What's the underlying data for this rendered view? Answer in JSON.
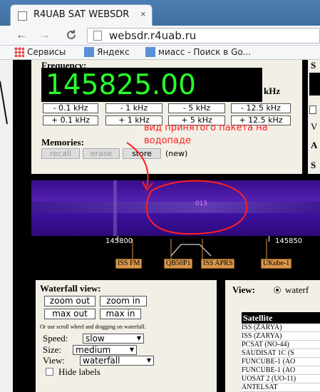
{
  "browser": {
    "tab_title": "R4UAB SAT WEBSDR",
    "tab_close": "×",
    "back": "←",
    "forward": "→",
    "reload": "C",
    "url": "websdr.r4uab.ru",
    "bookmarks": [
      {
        "label": "Сервисы",
        "icon": "apps-grid-icon"
      },
      {
        "label": "Яндекс",
        "icon": "bookmark-icon"
      },
      {
        "label": "миасс - Поиск в Go...",
        "icon": "bookmark-icon"
      }
    ]
  },
  "frequency": {
    "label": "Frequency:",
    "value": "145825.00",
    "unit": "kHz",
    "steps_row1": [
      "- 0.1 kHz",
      "- 1 kHz",
      "- 5 kHz",
      "- 12.5 kHz"
    ],
    "steps_row2": [
      "+ 0.1 kHz",
      "+ 1 kHz",
      "+ 5 kHz",
      "+ 12.5 kHz"
    ]
  },
  "memories": {
    "label": "Memories:",
    "recall": "recall",
    "erase": "erase",
    "store": "store",
    "new": "(new)"
  },
  "right_panel_letters": [
    "S",
    "V",
    "A",
    "S"
  ],
  "annotation": "вид принятого пакета на водопаде",
  "waterfall_signal_text": "015",
  "scale": {
    "tick_left": "145800",
    "tick_right": "145850",
    "satellites": [
      "ISS FM",
      "QB50P1",
      "ISS APRS",
      "UKube-1"
    ]
  },
  "waterfall_view": {
    "title": "Waterfall view:",
    "zoom_out": "zoom out",
    "zoom_in": "zoom in",
    "max_out": "max out",
    "max_in": "max in",
    "hint": "Or use scroll wheel and dragging on waterfall.",
    "speed_label": "Speed:",
    "speed_value": "slow",
    "size_label": "Size:",
    "size_value": "medium",
    "view_label": "View:",
    "view_value": "waterfall",
    "hide_labels": "Hide labels"
  },
  "side_view": {
    "label": "View:",
    "value": "waterf"
  },
  "satellite_table": {
    "header": "Satellite",
    "rows": [
      "ISS (ZARYA)",
      "ISS (ZARYA)",
      "PCSAT (NO-44)",
      "SAUDISAT 1C (S",
      "FUNCUBE-1 (AO",
      "FUNCUBE-1 (AO",
      "UOSAT 2 (UO-11)",
      "ANTELSAT"
    ]
  },
  "colors": {
    "freq_digits": "#2aff2a",
    "annotation": "#ff2020",
    "satellite_tag": "#d9964a",
    "waterfall": "#4a1aa8"
  }
}
